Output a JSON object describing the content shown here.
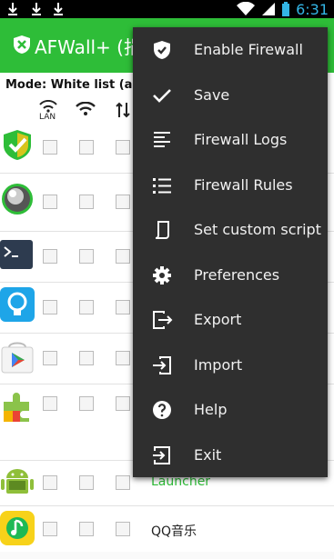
{
  "statusbar": {
    "time": "6:31"
  },
  "actionbar": {
    "title": "AFWall+ (捐"
  },
  "mode_label": "Mode: White list (allow",
  "columns": {
    "lan": "LAN"
  },
  "apps": [
    {
      "icon": "shield-check-icon",
      "name": ""
    },
    {
      "icon": "orb-app-icon",
      "name": ""
    },
    {
      "icon": "terminal-icon",
      "name": ""
    },
    {
      "icon": "lightbulb-app-icon",
      "name": ""
    },
    {
      "icon": "play-store-icon",
      "name": ""
    },
    {
      "icon": "puzzle-app-icon",
      "name": ""
    },
    {
      "icon": "android-icon",
      "name": "Launcher"
    },
    {
      "icon": "qq-music-icon",
      "name": "QQ音乐"
    }
  ],
  "menu": {
    "items": [
      {
        "label": "Enable Firewall",
        "icon": "shield-icon"
      },
      {
        "label": "Save",
        "icon": "check-icon"
      },
      {
        "label": "Firewall Logs",
        "icon": "logs-icon"
      },
      {
        "label": "Firewall Rules",
        "icon": "list-icon"
      },
      {
        "label": "Set custom script",
        "icon": "script-icon"
      },
      {
        "label": "Preferences",
        "icon": "gear-icon"
      },
      {
        "label": "Export",
        "icon": "export-icon"
      },
      {
        "label": "Import",
        "icon": "import-icon"
      },
      {
        "label": "Help",
        "icon": "help-icon"
      },
      {
        "label": "Exit",
        "icon": "exit-icon"
      }
    ]
  },
  "colors": {
    "actionbar": "#2ebd38",
    "menu_bg": "#2f2f2f",
    "accent": "#33b5e5",
    "launcher_text": "#2ebd38"
  }
}
